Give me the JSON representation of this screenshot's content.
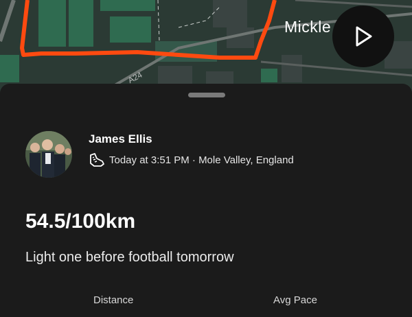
{
  "map": {
    "place_label": "Mickle",
    "road_label": "A24",
    "colors": {
      "background": "#2b3a34",
      "route": "#ff4a10",
      "fields": "#2f6b50",
      "roads": "#6f7673"
    }
  },
  "play_button": {
    "icon": "play-icon"
  },
  "activity": {
    "athlete_name": "James Ellis",
    "activity_icon": "shoe-icon",
    "meta": "Today at 3:51 PM · Mole Valley, England",
    "title": "54.5/100km",
    "description": "Light one before football tomorrow"
  },
  "stats": {
    "distance_label": "Distance",
    "pace_label": "Avg Pace"
  },
  "colors": {
    "sheet": "#1b1b1b",
    "text_primary": "#ffffff",
    "handle": "#7a7a7a"
  }
}
